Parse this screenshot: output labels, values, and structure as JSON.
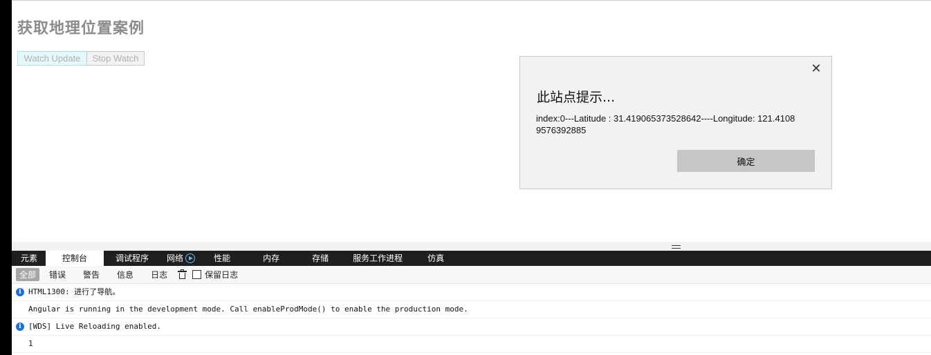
{
  "page": {
    "title": "获取地理位置案例",
    "buttons": {
      "watch_update": "Watch Update",
      "stop_watch": "Stop Watch"
    }
  },
  "alert": {
    "close_glyph": "✕",
    "title": "此站点提示...",
    "message": "index:0---Latitude : 31.419065373528642----Longitude: 121.41089576392885",
    "ok_label": "确定"
  },
  "devtools": {
    "tabs": [
      {
        "label": "元素"
      },
      {
        "label": "控制台",
        "active": true
      },
      {
        "label": "调试程序"
      },
      {
        "label": "网络",
        "icon": "play-circle-icon"
      },
      {
        "label": "性能"
      },
      {
        "label": "内存"
      },
      {
        "label": "存储"
      },
      {
        "label": "服务工作进程"
      },
      {
        "label": "仿真"
      }
    ],
    "filters": {
      "all": "全部",
      "errors": "错误",
      "warnings": "警告",
      "info": "信息",
      "logs": "日志"
    },
    "preserve_log_label": "保留日志",
    "preserve_log_checked": false,
    "log_entries": [
      {
        "level": "info",
        "text": "HTML1300: 进行了导航。"
      },
      {
        "level": "log",
        "text": "Angular is running in the development mode. Call enableProdMode() to enable the production mode."
      },
      {
        "level": "info",
        "text": "[WDS] Live Reloading enabled."
      },
      {
        "level": "log",
        "text": "1"
      }
    ]
  },
  "colors": {
    "tab_bar": "#1f1f1f",
    "info_icon": "#1e6fd0",
    "network_icon": "#6cb5f5"
  }
}
